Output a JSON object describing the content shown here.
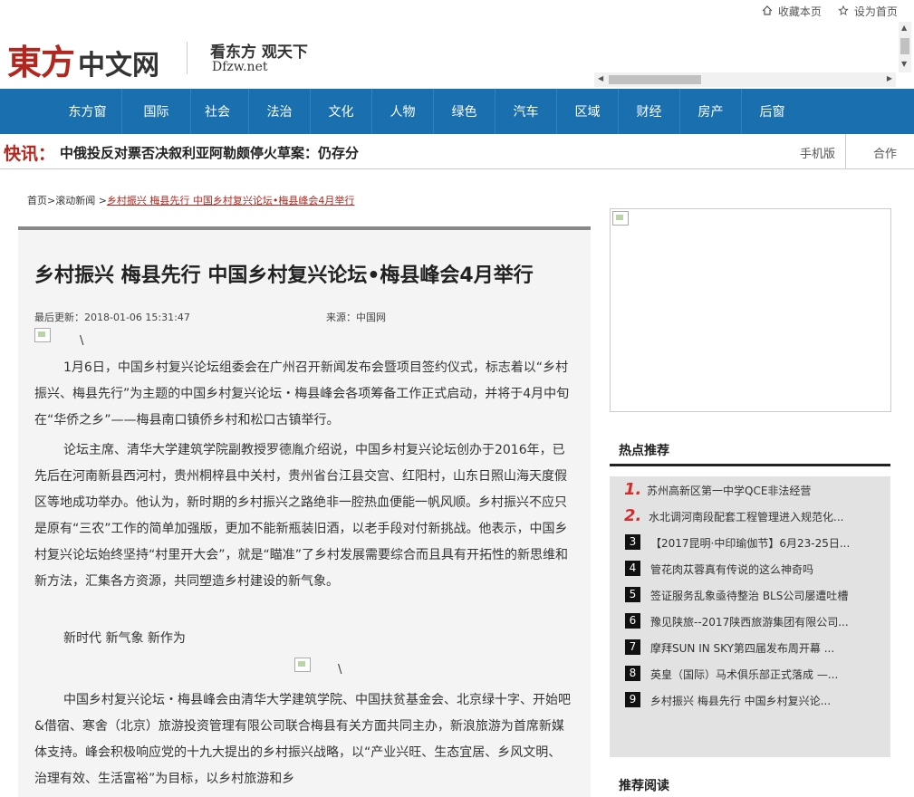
{
  "topbar": {
    "bookmark_label": "收藏本页",
    "homepage_label": "设为首页"
  },
  "logo": {
    "brand": "東方",
    "suffix": "中文网",
    "slogan": "看东方 观天下",
    "url_text": "Dfzw.net"
  },
  "nav": {
    "items": [
      "东方窗",
      "国际",
      "社会",
      "法治",
      "文化",
      "人物",
      "绿色",
      "汽车",
      "区域",
      "财经",
      "房产",
      "后窗"
    ]
  },
  "flash": {
    "label": "快讯：",
    "headline": "中俄投反对票否决叙利亚阿勒颇停火草案：仍存分",
    "mobile_label": "手机版",
    "coop_label": "合作"
  },
  "breadcrumb": {
    "home": "首页",
    "sep1": ">",
    "section": "滚动新闻",
    "sep2": " >",
    "current": "乡村振兴 梅县先行 中国乡村复兴论坛•梅县峰会4月举行"
  },
  "article": {
    "title": "乡村振兴 梅县先行 中国乡村复兴论坛•梅县峰会4月举行",
    "updated": "最后更新：2018-01-06 15:31:47",
    "source": "来源：中国网",
    "paragraphs": [
      "1月6日，中国乡村复兴论坛组委会在广州召开新闻发布会暨项目签约仪式，标志着以“乡村振兴、梅县先行”为主题的中国乡村复兴论坛・梅县峰会各项筹备工作正式启动，并将于4月中旬在“华侨之乡”——梅县南口镇侨乡村和松口古镇举行。",
      "论坛主席、清华大学建筑学院副教授罗德胤介绍说，中国乡村复兴论坛创办于2016年，已先后在河南新县西河村，贵州桐梓县中关村，贵州省台江县交宫、红阳村，山东日照山海天度假区等地成功举办。他认为，新时期的乡村振兴之路绝非一腔热血便能一帆风顺。乡村振兴不应只是原有“三农”工作的简单加强版，更加不能新瓶装旧酒，以老手段对付新挑战。他表示，中国乡村复兴论坛始终坚持“村里开大会”，就是“瞄准”了乡村发展需要综合而且具有开拓性的新思维和新方法，汇集各方资源，共同塑造乡村建设的新气象。",
      "新时代 新气象 新作为",
      "中国乡村复兴论坛・梅县峰会由清华大学建筑学院、中国扶贫基金会、北京绿十字、开始吧&借宿、寒舍（北京）旅游投资管理有限公司联合梅县有关方面共同主办，新浪旅游为首席新媒体支持。峰会积极响应党的十九大提出的乡村振兴战略，以“产业兴旺、生态宜居、乡风文明、治理有效、生活富裕”为目标，以乡村旅游和乡"
    ]
  },
  "sidebar": {
    "hot_title": "热点推荐",
    "hot_items": [
      {
        "rank": "1.",
        "text": "苏州高新区第一中学QCE非法经营"
      },
      {
        "rank": "2.",
        "text": "水北调河南段配套工程管理进入规范化..."
      },
      {
        "rank": "3",
        "text": "【2017昆明·中印瑜伽节】6月23-25日..."
      },
      {
        "rank": "4",
        "text": "管花肉苁蓉真有传说的这么神奇吗"
      },
      {
        "rank": "5",
        "text": "签证服务乱象亟待整治 BLS公司屡遭吐槽"
      },
      {
        "rank": "6",
        "text": "豫见陕旅--2017陕西旅游集团有限公司..."
      },
      {
        "rank": "7",
        "text": "摩拜SUN IN SKY第四届发布周开幕 ..."
      },
      {
        "rank": "8",
        "text": "英皇（国际）马术俱乐部正式落成 —..."
      },
      {
        "rank": "9",
        "text": "乡村振兴 梅县先行 中国乡村复兴论..."
      }
    ],
    "recommend_title": "推荐阅读"
  },
  "colors": {
    "brand_red": "#b3261e",
    "nav_blue": "#1a6fae",
    "rank_red": "#d42b2b"
  },
  "icons": {
    "bookmark": "house-icon",
    "homepage": "star-icon"
  }
}
